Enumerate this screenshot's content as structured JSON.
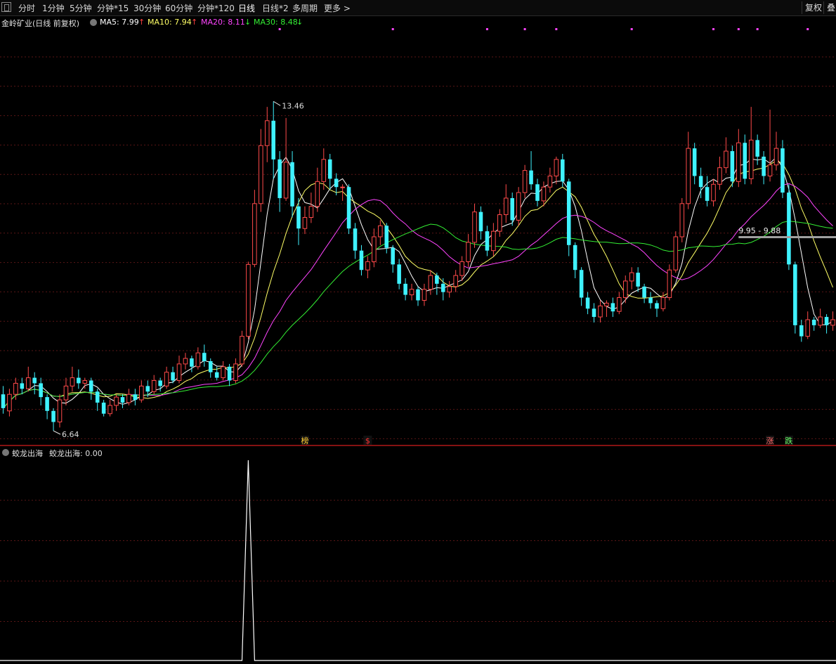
{
  "toolbar": {
    "items": [
      "分时",
      "1分钟",
      "5分钟",
      "分钟*15",
      "30分钟",
      "60分钟",
      "分钟*120",
      "日线",
      "日线*2",
      "多周期",
      "更多 >"
    ],
    "active_index": 7,
    "right_buttons": [
      "复权",
      "叠"
    ]
  },
  "legend": {
    "title": "金岭矿业(日线 前复权)",
    "ma5": "MA5: 7.99",
    "ma10": "MA10: 7.94",
    "ma20": "MA20: 8.11",
    "ma30": "MA30: 8.48",
    "arrow_up": "↑",
    "arrow_down": "↓",
    "colors": {
      "ma5": "#ffffff",
      "ma10": "#ffff66",
      "ma20": "#ff44ff",
      "ma30": "#33ee33"
    }
  },
  "annotations": {
    "high_label": "13.46",
    "low_label": "6.64",
    "range_label": "9.95 - 9.88"
  },
  "markers": {
    "bang": "榜",
    "dollar": "$",
    "zhang": "涨",
    "die": "跌"
  },
  "indicator": {
    "name": "蛟龙出海",
    "value_label": "蛟龙出海: 0.00",
    "spike_value": 1
  },
  "colors": {
    "up": "#ff4a4a",
    "down": "#3ff2ff",
    "grid": "#5a1616",
    "divider": "#b01818"
  },
  "chart_data": {
    "type": "candlestick",
    "title": "金岭矿业(日线 前复权)",
    "ylim": [
      6.4,
      13.9
    ],
    "high": 13.46,
    "low": 6.64,
    "ohlc": [
      [
        7.3,
        7.05,
        7.45,
        6.95
      ],
      [
        7.0,
        7.3,
        7.4,
        6.9
      ],
      [
        7.3,
        7.5,
        7.6,
        7.2
      ],
      [
        7.5,
        7.4,
        7.6,
        7.3
      ],
      [
        7.4,
        7.6,
        7.8,
        7.35
      ],
      [
        7.6,
        7.5,
        7.7,
        7.3
      ],
      [
        7.5,
        7.25,
        7.6,
        7.1
      ],
      [
        7.25,
        7.0,
        7.3,
        6.85
      ],
      [
        7.0,
        6.8,
        7.05,
        6.64
      ],
      [
        6.8,
        7.2,
        7.3,
        6.7
      ],
      [
        7.2,
        7.45,
        7.6,
        7.1
      ],
      [
        7.45,
        7.6,
        7.8,
        7.35
      ],
      [
        7.6,
        7.5,
        7.75,
        7.4
      ],
      [
        7.5,
        7.55,
        7.6,
        7.4
      ],
      [
        7.55,
        7.35,
        7.6,
        7.2
      ],
      [
        7.35,
        7.15,
        7.4,
        7.0
      ],
      [
        7.15,
        6.95,
        7.2,
        6.9
      ],
      [
        6.95,
        7.1,
        7.2,
        6.9
      ],
      [
        7.1,
        7.25,
        7.3,
        7.0
      ],
      [
        7.25,
        7.15,
        7.3,
        7.05
      ],
      [
        7.15,
        7.3,
        7.4,
        7.1
      ],
      [
        7.3,
        7.2,
        7.4,
        7.1
      ],
      [
        7.2,
        7.45,
        7.55,
        7.15
      ],
      [
        7.45,
        7.35,
        7.55,
        7.25
      ],
      [
        7.35,
        7.55,
        7.65,
        7.3
      ],
      [
        7.55,
        7.45,
        7.6,
        7.35
      ],
      [
        7.45,
        7.7,
        7.8,
        7.4
      ],
      [
        7.7,
        7.55,
        7.8,
        7.5
      ],
      [
        7.55,
        7.85,
        8.0,
        7.5
      ],
      [
        7.85,
        7.95,
        8.05,
        7.75
      ],
      [
        7.95,
        7.8,
        8.0,
        7.7
      ],
      [
        7.8,
        8.05,
        8.15,
        7.75
      ],
      [
        8.05,
        7.9,
        8.2,
        7.8
      ],
      [
        7.9,
        7.7,
        7.95,
        7.6
      ],
      [
        7.7,
        7.6,
        7.8,
        7.55
      ],
      [
        7.6,
        7.8,
        7.9,
        7.55
      ],
      [
        7.8,
        7.55,
        7.85,
        7.45
      ],
      [
        7.55,
        7.85,
        7.95,
        7.5
      ],
      [
        7.85,
        8.35,
        8.45,
        7.8
      ],
      [
        8.35,
        9.65,
        9.7,
        8.3
      ],
      [
        9.65,
        10.75,
        11.0,
        9.6
      ],
      [
        10.75,
        11.8,
        12.1,
        10.6
      ],
      [
        11.8,
        12.25,
        12.5,
        11.5
      ],
      [
        12.25,
        11.55,
        12.6,
        11.2
      ],
      [
        11.55,
        10.85,
        11.7,
        10.6
      ],
      [
        10.85,
        11.5,
        12.3,
        10.8
      ],
      [
        11.5,
        10.7,
        11.7,
        10.5
      ],
      [
        10.7,
        10.3,
        10.85,
        10.0
      ],
      [
        10.3,
        10.5,
        10.7,
        10.2
      ],
      [
        10.5,
        10.7,
        10.95,
        10.4
      ],
      [
        10.7,
        11.15,
        11.4,
        10.6
      ],
      [
        11.15,
        11.55,
        11.75,
        11.0
      ],
      [
        11.55,
        11.2,
        11.65,
        11.0
      ],
      [
        11.2,
        11.05,
        11.3,
        10.9
      ],
      [
        11.05,
        11.05,
        11.1,
        10.8
      ],
      [
        11.05,
        10.3,
        11.1,
        10.2
      ],
      [
        10.3,
        9.9,
        10.4,
        9.75
      ],
      [
        9.9,
        9.55,
        10.0,
        9.45
      ],
      [
        9.55,
        9.7,
        9.8,
        9.4
      ],
      [
        9.7,
        10.15,
        10.3,
        9.6
      ],
      [
        10.15,
        10.35,
        10.45,
        10.0
      ],
      [
        10.35,
        9.95,
        10.4,
        9.85
      ],
      [
        9.95,
        9.65,
        10.0,
        9.5
      ],
      [
        9.65,
        9.3,
        9.75,
        9.2
      ],
      [
        9.3,
        9.1,
        9.4,
        9.0
      ],
      [
        9.1,
        9.2,
        9.3,
        9.0
      ],
      [
        9.2,
        9.0,
        9.25,
        8.9
      ],
      [
        9.0,
        9.2,
        9.3,
        8.9
      ],
      [
        9.2,
        9.45,
        9.55,
        9.1
      ],
      [
        9.45,
        9.3,
        9.5,
        9.1
      ],
      [
        9.3,
        9.15,
        9.4,
        9.0
      ],
      [
        9.15,
        9.25,
        9.35,
        9.05
      ],
      [
        9.25,
        9.45,
        9.55,
        9.15
      ],
      [
        9.45,
        9.7,
        9.8,
        9.35
      ],
      [
        9.7,
        10.05,
        10.2,
        9.6
      ],
      [
        10.05,
        10.6,
        10.75,
        9.95
      ],
      [
        10.6,
        10.25,
        10.7,
        10.1
      ],
      [
        10.25,
        9.9,
        10.35,
        9.8
      ],
      [
        9.9,
        10.25,
        10.4,
        9.8
      ],
      [
        10.25,
        10.55,
        10.65,
        10.15
      ],
      [
        10.55,
        10.85,
        11.1,
        10.4
      ],
      [
        10.85,
        10.45,
        10.95,
        10.35
      ],
      [
        10.45,
        10.95,
        11.05,
        10.35
      ],
      [
        10.95,
        11.35,
        11.45,
        10.85
      ],
      [
        11.35,
        11.1,
        11.7,
        11.0
      ],
      [
        11.1,
        10.8,
        11.2,
        10.7
      ],
      [
        10.8,
        11.05,
        11.15,
        10.7
      ],
      [
        11.05,
        11.25,
        11.4,
        10.95
      ],
      [
        11.25,
        11.55,
        11.6,
        11.1
      ],
      [
        11.55,
        11.15,
        11.65,
        11.05
      ],
      [
        11.15,
        10.0,
        11.2,
        9.8
      ],
      [
        10.0,
        9.55,
        10.05,
        9.4
      ],
      [
        9.55,
        9.05,
        9.6,
        8.9
      ],
      [
        9.05,
        8.85,
        9.15,
        8.75
      ],
      [
        8.85,
        8.7,
        8.95,
        8.6
      ],
      [
        8.7,
        8.9,
        9.0,
        8.6
      ],
      [
        8.9,
        8.95,
        9.0,
        8.7
      ],
      [
        8.95,
        8.8,
        9.05,
        8.7
      ],
      [
        8.8,
        9.05,
        9.15,
        8.75
      ],
      [
        9.05,
        9.35,
        9.45,
        8.95
      ],
      [
        9.35,
        9.5,
        9.6,
        9.2
      ],
      [
        9.5,
        9.25,
        9.6,
        9.15
      ],
      [
        9.25,
        9.05,
        9.3,
        8.95
      ],
      [
        9.05,
        8.95,
        9.15,
        8.85
      ],
      [
        8.95,
        8.85,
        9.0,
        8.7
      ],
      [
        8.85,
        9.05,
        9.15,
        8.8
      ],
      [
        9.05,
        9.55,
        9.65,
        9.0
      ],
      [
        9.55,
        10.15,
        10.25,
        9.5
      ],
      [
        10.15,
        10.75,
        10.85,
        10.05
      ],
      [
        10.75,
        11.75,
        12.05,
        10.65
      ],
      [
        11.75,
        11.25,
        11.85,
        11.1
      ],
      [
        11.25,
        11.05,
        11.4,
        10.85
      ],
      [
        11.05,
        10.8,
        11.25,
        10.7
      ],
      [
        10.8,
        11.1,
        11.2,
        10.7
      ],
      [
        11.1,
        11.4,
        11.6,
        11.0
      ],
      [
        11.4,
        11.7,
        11.95,
        11.3
      ],
      [
        11.7,
        11.15,
        11.8,
        11.05
      ],
      [
        11.15,
        11.85,
        12.1,
        11.05
      ],
      [
        11.85,
        11.2,
        12.0,
        11.1
      ],
      [
        11.2,
        11.9,
        12.5,
        11.1
      ],
      [
        11.9,
        11.6,
        12.0,
        11.45
      ],
      [
        11.6,
        11.25,
        11.7,
        11.1
      ],
      [
        11.25,
        11.45,
        12.45,
        11.15
      ],
      [
        11.45,
        11.75,
        12.05,
        11.35
      ],
      [
        11.75,
        10.95,
        11.9,
        10.85
      ],
      [
        10.95,
        9.65,
        11.1,
        9.55
      ],
      [
        9.65,
        8.55,
        9.7,
        8.4
      ],
      [
        8.55,
        8.35,
        8.65,
        8.25
      ],
      [
        8.35,
        8.65,
        8.8,
        8.3
      ],
      [
        8.65,
        8.55,
        8.7,
        8.45
      ],
      [
        8.55,
        8.7,
        8.85,
        8.5
      ],
      [
        8.7,
        8.55,
        8.75,
        8.4
      ],
      [
        8.55,
        8.65,
        8.8,
        8.45
      ]
    ],
    "ma": [
      {
        "name": "MA5",
        "period": 5,
        "color": "#ffffff"
      },
      {
        "name": "MA10",
        "period": 10,
        "color": "#ffff66"
      },
      {
        "name": "MA20",
        "period": 20,
        "color": "#ff44ff"
      },
      {
        "name": "MA30",
        "period": 30,
        "color": "#33ee33"
      }
    ],
    "signals": [
      0,
      0,
      0,
      0,
      0,
      0,
      0,
      0,
      0,
      0,
      0,
      0,
      0,
      0,
      0,
      0,
      0,
      0,
      0,
      0,
      0,
      0,
      0,
      0,
      0,
      0,
      0,
      0,
      0,
      0,
      0,
      0,
      0,
      0,
      0,
      0,
      0,
      0,
      0,
      1,
      0,
      0,
      0,
      0,
      0,
      0,
      0,
      0,
      0,
      0,
      0,
      0,
      0,
      0,
      0,
      0,
      0,
      0,
      0,
      0,
      0,
      0,
      0,
      0,
      0,
      0,
      0,
      0,
      0,
      0,
      0,
      0,
      0,
      0,
      0,
      0,
      0,
      0,
      0,
      0,
      0,
      0,
      0,
      0,
      0,
      0,
      0,
      0,
      0,
      0,
      0,
      0,
      0,
      0,
      0,
      0,
      0,
      0,
      0,
      0,
      0,
      0,
      0,
      0,
      0,
      0,
      0,
      0,
      0,
      0,
      0,
      0,
      0,
      0,
      0,
      0,
      0,
      0,
      0,
      0,
      0,
      0,
      0,
      0,
      0,
      0,
      0,
      0,
      0,
      0,
      0,
      0,
      0,
      0,
      0
    ]
  }
}
